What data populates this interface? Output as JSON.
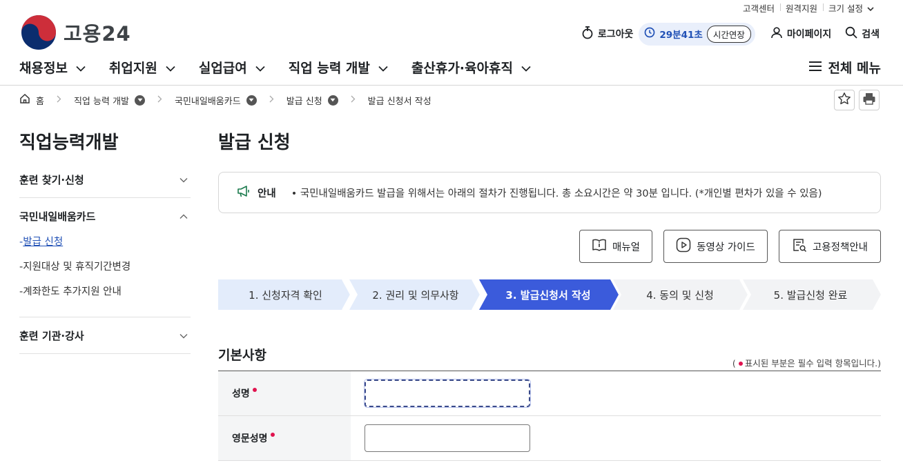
{
  "util": {
    "customer_center": "고객센터",
    "remote_support": "원격지원",
    "font_size": "크기 설정"
  },
  "logo": {
    "text": "고용24"
  },
  "header": {
    "logout": "로그아웃",
    "session_time": "29분41초",
    "extend": "시간연장",
    "mypage": "마이페이지",
    "search": "검색"
  },
  "gnb": {
    "items": [
      {
        "label": "채용정보"
      },
      {
        "label": "취업지원"
      },
      {
        "label": "실업급여"
      },
      {
        "label": "직업 능력 개발"
      },
      {
        "label": "출산휴가·육아휴직"
      }
    ],
    "all_menu": "전체 메뉴"
  },
  "breadcrumb": {
    "home": "홈",
    "items": [
      "직업 능력 개발",
      "국민내일배움카드",
      "발급 신청",
      "발급 신청서 작성"
    ]
  },
  "sidebar": {
    "title": "직업능력개발",
    "groups": [
      {
        "label": "훈련 찾기·신청",
        "expanded": false
      },
      {
        "label": "국민내일배움카드",
        "expanded": true,
        "items": [
          {
            "label": "발급 신청",
            "active": true
          },
          {
            "label": "지원대상 및 휴직기간변경",
            "active": false
          },
          {
            "label": "계좌한도 추가지원 안내",
            "active": false
          }
        ]
      },
      {
        "label": "훈련 기관·강사",
        "expanded": false
      }
    ]
  },
  "main": {
    "title": "발급 신청",
    "notice_label": "안내",
    "notice_text": "• 국민내일배움카드 발급을 위해서는 아래의 절차가 진행됩니다. 총 소요시간은 약 30분 입니다. (*개인별 편차가 있을 수 있음)",
    "buttons": {
      "manual": "매뉴얼",
      "video": "동영상 가이드",
      "policy": "고용정책안내"
    },
    "steps": [
      {
        "label": "1. 신청자격 확인",
        "state": "done"
      },
      {
        "label": "2. 권리 및 의무사항",
        "state": "done"
      },
      {
        "label": "3. 발급신청서 작성",
        "state": "current"
      },
      {
        "label": "4. 동의 및 신청",
        "state": "todo"
      },
      {
        "label": "5. 발급신청 완료",
        "state": "todo"
      }
    ],
    "section_title": "기본사항",
    "required_note_prefix": "(",
    "required_note": "표시된 부분은 필수 입력 항목입니다.)",
    "fields": [
      {
        "label": "성명",
        "value": ""
      },
      {
        "label": "영문성명",
        "value": ""
      }
    ]
  },
  "colors": {
    "primary": "#3b5bdb",
    "step_done_bg": "#e3ecfb",
    "step_todo_bg": "#f2f3f5",
    "required": "#e0134f"
  }
}
